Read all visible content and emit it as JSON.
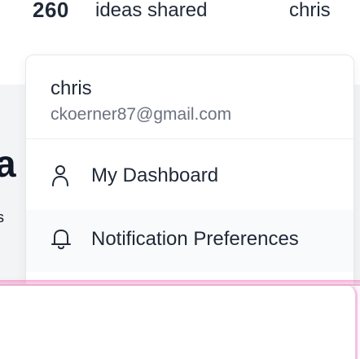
{
  "header": {
    "ideas_count": "260",
    "ideas_label": "ideas shared",
    "user_name": "chris"
  },
  "user_menu": {
    "name": "chris",
    "email": "ckoerner87@gmail.com",
    "items": [
      {
        "label": "My Dashboard",
        "icon": "user-icon"
      },
      {
        "label": "Notification Preferences",
        "icon": "bell-icon"
      }
    ]
  },
  "background": {
    "partial_glyph_1": "a",
    "partial_glyph_2": "s"
  },
  "colors": {
    "text": "#1f2937",
    "muted": "#6b7280",
    "divider": "#eceef1",
    "hover_bg": "#f9fafb",
    "accent_glow": "#f472b6"
  }
}
